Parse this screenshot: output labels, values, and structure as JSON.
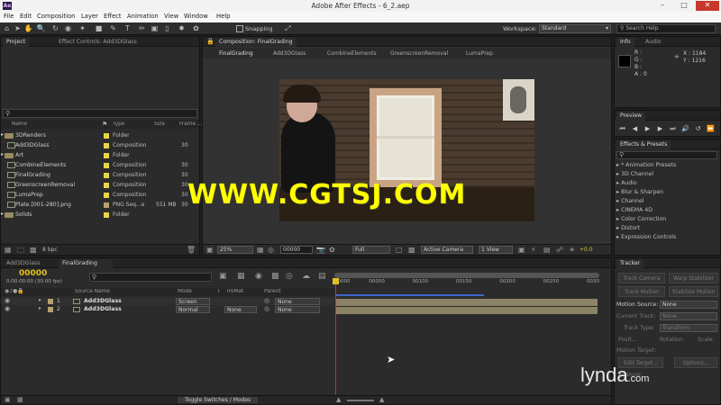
{
  "window": {
    "title": "Adobe After Effects - 6_2.aep",
    "logo": "Ae"
  },
  "menu": [
    "File",
    "Edit",
    "Composition",
    "Layer",
    "Effect",
    "Animation",
    "View",
    "Window",
    "Help"
  ],
  "toolbar": {
    "snapping": "Snapping",
    "workspace_label": "Workspace:",
    "workspace_value": "Standard",
    "search_placeholder": "Search Help"
  },
  "project_panel": {
    "tab_project": "Project",
    "tab_effect_controls": "Effect Controls: Add3DGlass",
    "columns": {
      "name": "Name",
      "type": "Type",
      "size": "Size",
      "frame": "Frame ..."
    },
    "items": [
      {
        "name": "3DRenders",
        "type": "Folder",
        "size": "",
        "frames": "",
        "color": "#e6d64a",
        "kind": "folder"
      },
      {
        "name": "Add3DGlass",
        "type": "Composition",
        "size": "",
        "frames": "30",
        "color": "#e6d64a",
        "kind": "comp"
      },
      {
        "name": "Art",
        "type": "Folder",
        "size": "",
        "frames": "",
        "color": "#e6d64a",
        "kind": "folder"
      },
      {
        "name": "CombineElements",
        "type": "Composition",
        "size": "",
        "frames": "30",
        "color": "#e6d64a",
        "kind": "comp"
      },
      {
        "name": "FinalGrading",
        "type": "Composition",
        "size": "",
        "frames": "30",
        "color": "#e6d64a",
        "kind": "comp"
      },
      {
        "name": "GreenscreenRemoval",
        "type": "Composition",
        "size": "",
        "frames": "30",
        "color": "#e6d64a",
        "kind": "comp"
      },
      {
        "name": "LumaPrep",
        "type": "Composition",
        "size": "",
        "frames": "30",
        "color": "#e6d64a",
        "kind": "comp"
      },
      {
        "name": "Plate.[001-280].png",
        "type": "PNG Seq...e",
        "size": "551 MB",
        "frames": "30",
        "color": "#b8a070",
        "kind": "file"
      },
      {
        "name": "Solids",
        "type": "Folder",
        "size": "",
        "frames": "",
        "color": "#e6d64a",
        "kind": "folder"
      }
    ],
    "bpc": "8 bpc"
  },
  "composition_panel": {
    "tab": "Composition: FinalGrading",
    "nav": [
      "FinalGrading",
      "Add3DGlass",
      "CombineElements",
      "GreenscreenRemoval",
      "LumaPrep"
    ],
    "zoom": "25%",
    "timecode": "00000",
    "resolution": "Full",
    "camera": "Active Camera",
    "view": "1 View",
    "exposure": "+0.0"
  },
  "watermark": "WWW.CGTSJ.COM",
  "info_panel": {
    "tab_info": "Info",
    "tab_audio": "Audio",
    "r_label": "R :",
    "g_label": "G :",
    "b_label": "B :",
    "a_label": "A : 0",
    "x": "X : 1184",
    "y": "Y : 1216"
  },
  "preview_panel": {
    "tab": "Preview"
  },
  "effects_panel": {
    "tab": "Effects & Presets",
    "items": [
      "* Animation Presets",
      "3D Channel",
      "Audio",
      "Blur & Sharpen",
      "Channel",
      "CINEMA 4D",
      "Color Correction",
      "Distort",
      "Expression Controls"
    ]
  },
  "timeline": {
    "tabs": [
      "Add3DGlass",
      "FinalGrading"
    ],
    "timecode": "00000",
    "timecode_sub": "0:00:00:00 (30.00 fps)",
    "columns": {
      "source": "Source Name",
      "mode": "Mode",
      "t": "T",
      "trkmat": "TrkMat",
      "parent": "Parent"
    },
    "ruler": [
      "00000",
      "00050",
      "00100",
      "00150",
      "00200",
      "00250",
      "0030"
    ],
    "layers": [
      {
        "num": "1",
        "name": "Add3DGlass",
        "mode": "Screen",
        "trkmat": "",
        "parent": "None"
      },
      {
        "num": "2",
        "name": "Add3DGlass",
        "mode": "Normal",
        "trkmat": "None",
        "parent": "None"
      }
    ],
    "toggle_label": "Toggle Switches / Modes"
  },
  "tracker_panel": {
    "tab": "Tracker",
    "track_camera": "Track Camera",
    "warp_stabilizer": "Warp Stabilizer",
    "track_motion": "Track Motion",
    "stabilize_motion": "Stabilize Motion",
    "motion_source_label": "Motion Source:",
    "motion_source_value": "None",
    "current_track_label": "Current Track:",
    "current_track_value": "None",
    "track_type_label": "Track Type:",
    "track_type_value": "Transform",
    "position": "Posit...",
    "rotation": "Rotation",
    "scale": "Scale",
    "motion_target": "Motion Target:",
    "edit_target": "Edit Target...",
    "options": "Options...",
    "analyze": "Analyze:"
  },
  "branding": {
    "lynda": "lynda",
    "lynda_suffix": ".com"
  }
}
